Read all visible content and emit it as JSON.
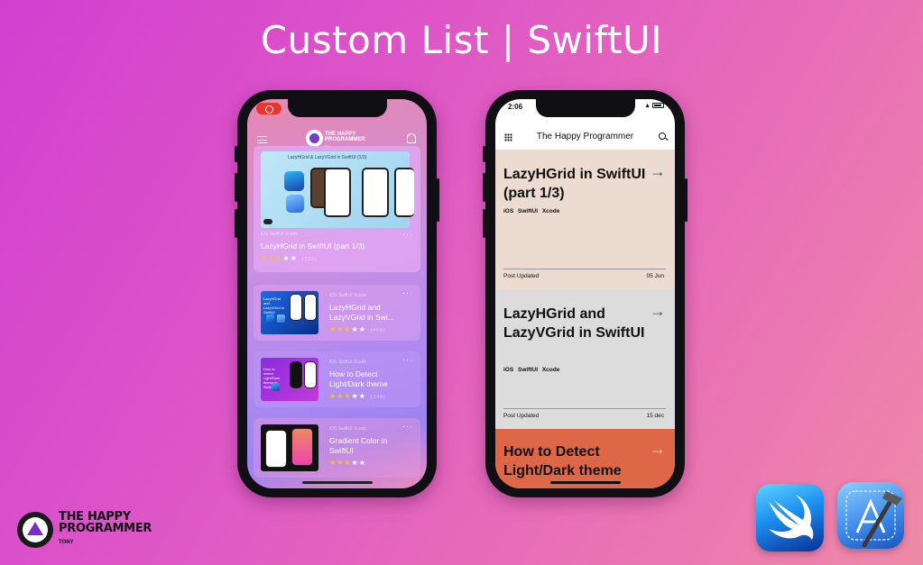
{
  "page": {
    "title": "Custom List | SwiftUI"
  },
  "left_phone": {
    "brand": "THE HAPPY PROGRAMMER",
    "brand_sub": "tony",
    "featured": {
      "image_caption": "LazyHGrid & LazyVGrid in SwiftUI (1/3)",
      "tags": "iOS  SwiftUI  Xcode",
      "title": "LazyHGrid in SwiftUI (part 1/3)",
      "rating": 3,
      "rating_count": "(123)"
    },
    "items": [
      {
        "tags": "iOS  SwiftUI  Xcode",
        "title": "LazyHGrid and LazyVGrid in Swi...",
        "rating": 3,
        "rating_count": "(456)",
        "thumb_text": "LazyHGrid and LazyVGrid in SwiftUI"
      },
      {
        "tags": "iOS  SwiftUI  Xcode",
        "title": "How to Detect Light/Dark theme",
        "rating": 3,
        "rating_count": "(348)",
        "thumb_text": "How to detect Light/Dark theme in SwiftUI"
      },
      {
        "tags": "iOS  SwiftUI  Xcode",
        "title": "Gradient Color in SwiftUI",
        "rating": 3,
        "rating_count": "",
        "thumb_text": ""
      }
    ]
  },
  "right_phone": {
    "status_time": "2:06",
    "app_title": "The Happy Programmer",
    "cards": [
      {
        "title": "LazyHGrid in SwiftUI (part 1/3)",
        "tags": "iOS SwiftUI Xcode",
        "footer": "Post Updated",
        "date": "05 Jun",
        "bg": "#ecdbd0"
      },
      {
        "title": "LazyHGrid and LazyVGrid in SwiftUI",
        "tags": "iOS SwiftUI Xcode",
        "footer": "Post Updated",
        "date": "15 dec",
        "bg": "#dcdcdc"
      },
      {
        "title": "How to Detect Light/Dark theme",
        "tags": "",
        "footer": "",
        "date": "",
        "bg": "#de6748"
      }
    ]
  },
  "branding": {
    "name_line1": "THE HAPPY",
    "name_line2": "PROGRAMMER",
    "sub": "TONY"
  },
  "icons": {
    "swift": "swift-icon",
    "xcode": "xcode-icon",
    "bell": "bell-icon",
    "menu": "menu-icon",
    "search": "search-icon",
    "grid": "grid-icon",
    "arrow": "arrow-right-icon"
  },
  "colors": {
    "star_on": "#f4c22a",
    "accent_orange": "#de6748"
  }
}
